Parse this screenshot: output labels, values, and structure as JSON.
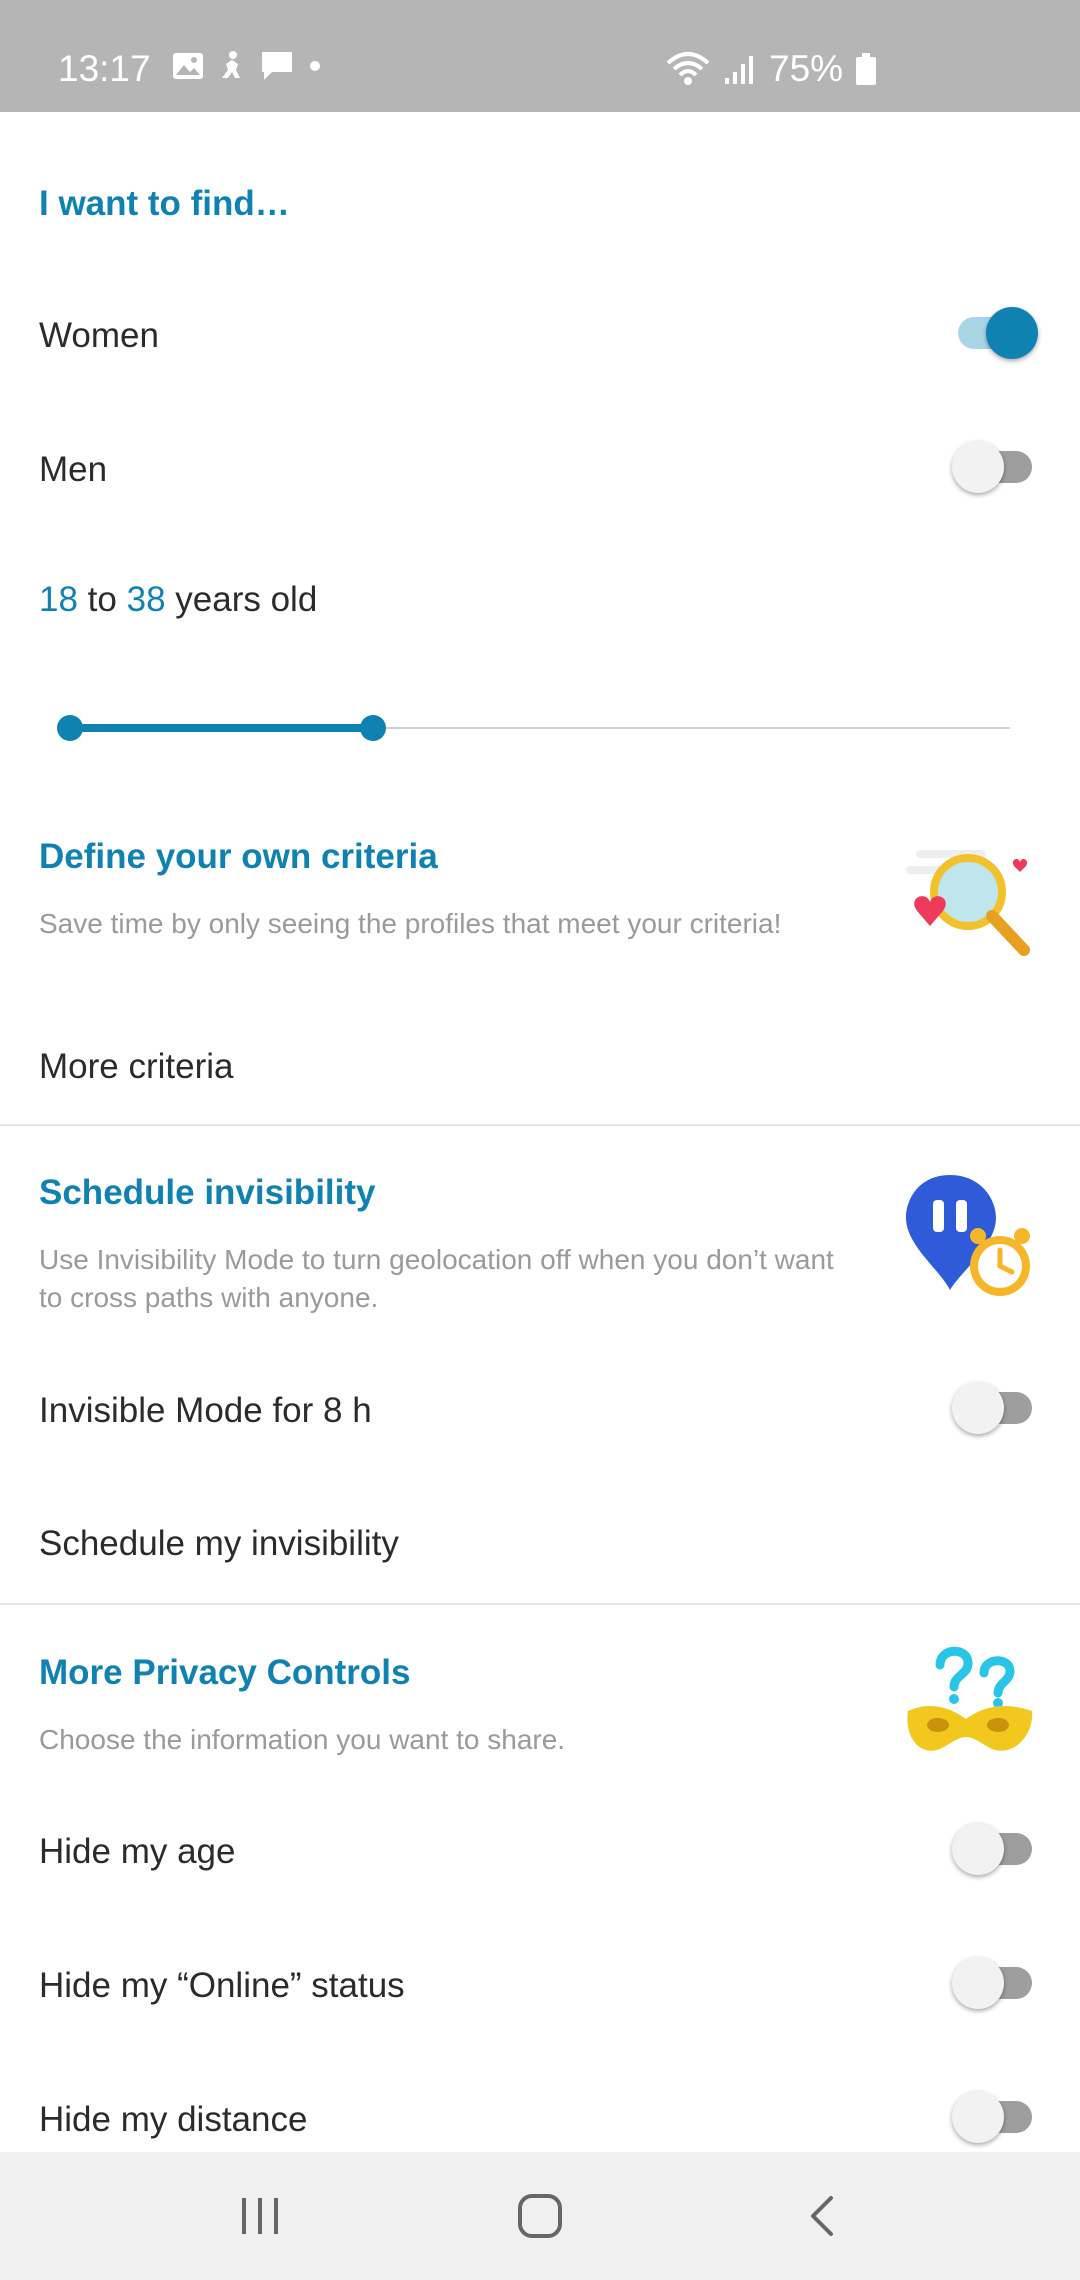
{
  "status_bar": {
    "time": "13:17",
    "battery": "75%",
    "notification_icons": [
      "image-icon",
      "activity-icon",
      "message-icon",
      "dot-icon"
    ],
    "system_icons": [
      "wifi-icon",
      "signal-icon",
      "battery-icon"
    ]
  },
  "find": {
    "heading": "I want to find…",
    "women_label": "Women",
    "women_on": true,
    "men_label": "Men",
    "men_on": false
  },
  "age": {
    "min": "18",
    "to": "to",
    "max": "38",
    "suffix": "years old",
    "slider_range": [
      18,
      80
    ],
    "accent_color": "#0f82b2"
  },
  "criteria": {
    "title": "Define your own criteria",
    "description": "Save time by only seeing the profiles that meet your criteria!",
    "link": "More criteria",
    "illustration": "magnifier-hearts-icon"
  },
  "invisibility": {
    "title": "Schedule invisibility",
    "description": "Use Invisibility Mode to turn geolocation off when you don’t want to cross paths with anyone.",
    "invisible_mode_label": "Invisible Mode for 8 h",
    "invisible_mode_on": false,
    "schedule_link": "Schedule my invisibility",
    "illustration": "pause-pin-alarm-icon"
  },
  "privacy": {
    "title": "More Privacy Controls",
    "description": "Choose the information you want to share.",
    "illustration": "mask-question-icon",
    "items": [
      {
        "label": "Hide my age",
        "on": false
      },
      {
        "label": "Hide my “Online” status",
        "on": false
      },
      {
        "label": "Hide my distance",
        "on": false
      }
    ]
  },
  "nav_bar": {
    "icons": [
      "recent-apps-icon",
      "home-icon",
      "back-icon"
    ]
  }
}
